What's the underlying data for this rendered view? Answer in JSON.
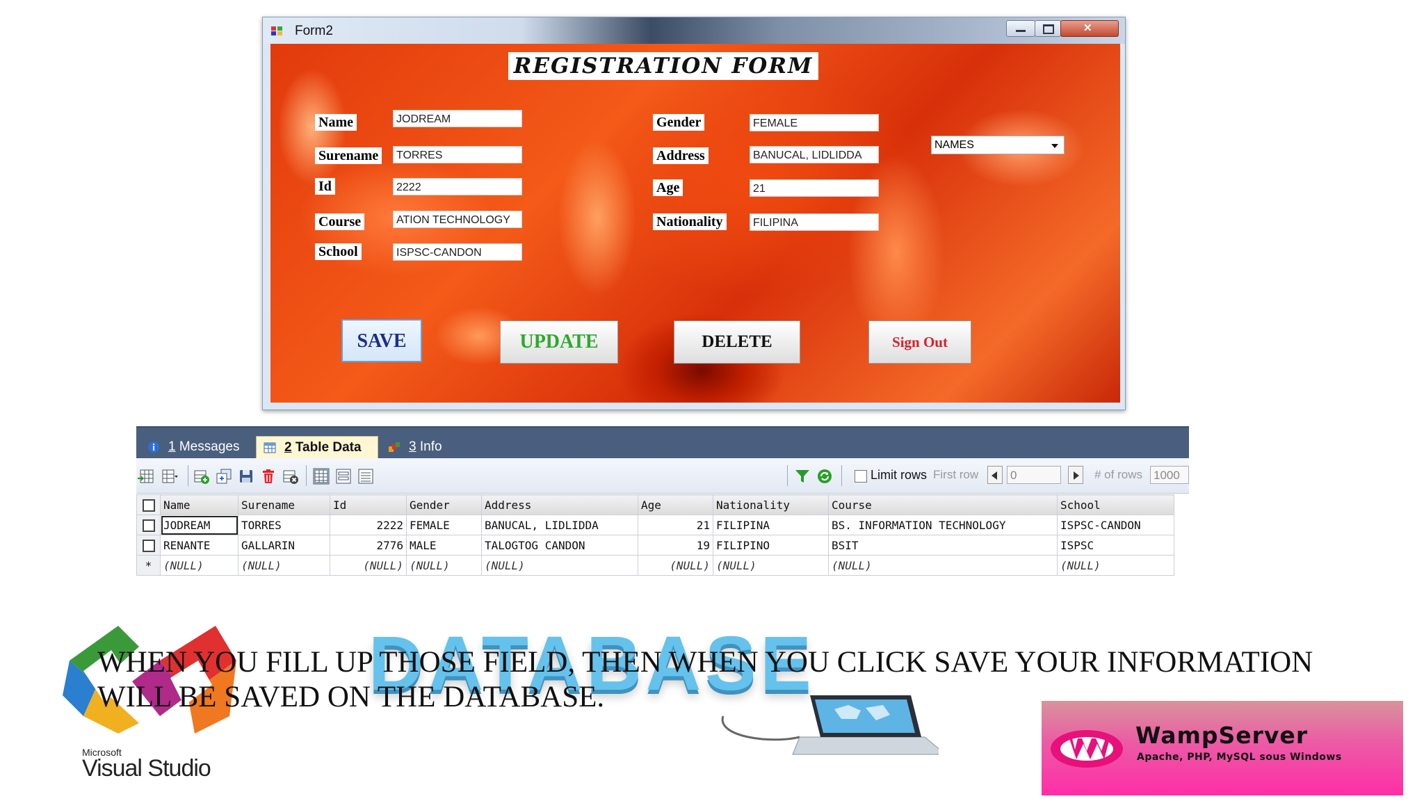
{
  "window": {
    "title": "Form2"
  },
  "form": {
    "heading": "REGISTRATION FORM",
    "labels": {
      "name": "Name",
      "surename": "Surename",
      "id": "Id",
      "course": "Course",
      "school": "School",
      "gender": "Gender",
      "address": "Address",
      "age": "Age",
      "nationality": "Nationality"
    },
    "values": {
      "name": "JODREAM",
      "surename": "TORRES",
      "id": "2222",
      "course": "ATION TECHNOLOGY",
      "school": "ISPSC-CANDON",
      "gender": "FEMALE",
      "address": "BANUCAL, LIDLIDDA",
      "age": "21",
      "nationality": "FILIPINA"
    },
    "names_select": "NAMES",
    "buttons": {
      "save": "SAVE",
      "update": "UPDATE",
      "delete": "DELETE",
      "signout": "Sign Out"
    }
  },
  "results": {
    "tabs": [
      {
        "num": "1",
        "label": " Messages"
      },
      {
        "num": "2",
        "label": " Table Data"
      },
      {
        "num": "3",
        "label": " Info"
      }
    ],
    "toolbar": {
      "limit_rows": "Limit rows",
      "first_row": "First row",
      "first_row_value": "0",
      "num_rows": "# of rows",
      "num_rows_value": "1000"
    },
    "columns": [
      "Name",
      "Surename",
      "Id",
      "Gender",
      "Address",
      "Age",
      "Nationality",
      "Course",
      "School"
    ],
    "rows": [
      [
        "JODREAM",
        "TORRES",
        "2222",
        "FEMALE",
        "BANUCAL, LIDLIDDA",
        "21",
        "FILIPINA",
        "BS. INFORMATION TECHNOLOGY",
        "ISPSC-CANDON"
      ],
      [
        "RENANTE",
        "GALLARIN",
        "2776",
        "MALE",
        "TALOGTOG CANDON",
        "19",
        "FILIPINO",
        "BSIT",
        "ISPSC"
      ],
      [
        "(NULL)",
        "(NULL)",
        "(NULL)",
        "(NULL)",
        "(NULL)",
        "(NULL)",
        "(NULL)",
        "(NULL)",
        "(NULL)"
      ]
    ],
    "new_row_marker": "*"
  },
  "caption": "WHEN YOU FILL UP THOSE FIELD, THEN WHEN YOU CLICK SAVE YOUR INFORMATION WILL BE SAVED ON THE DATABASE.",
  "logos": {
    "ms": "Microsoft",
    "vs": "Visual Studio",
    "db": "DATABASE",
    "wamp_name": "WampServer",
    "wamp_sub": "Apache, PHP, MySQL sous Windows"
  }
}
